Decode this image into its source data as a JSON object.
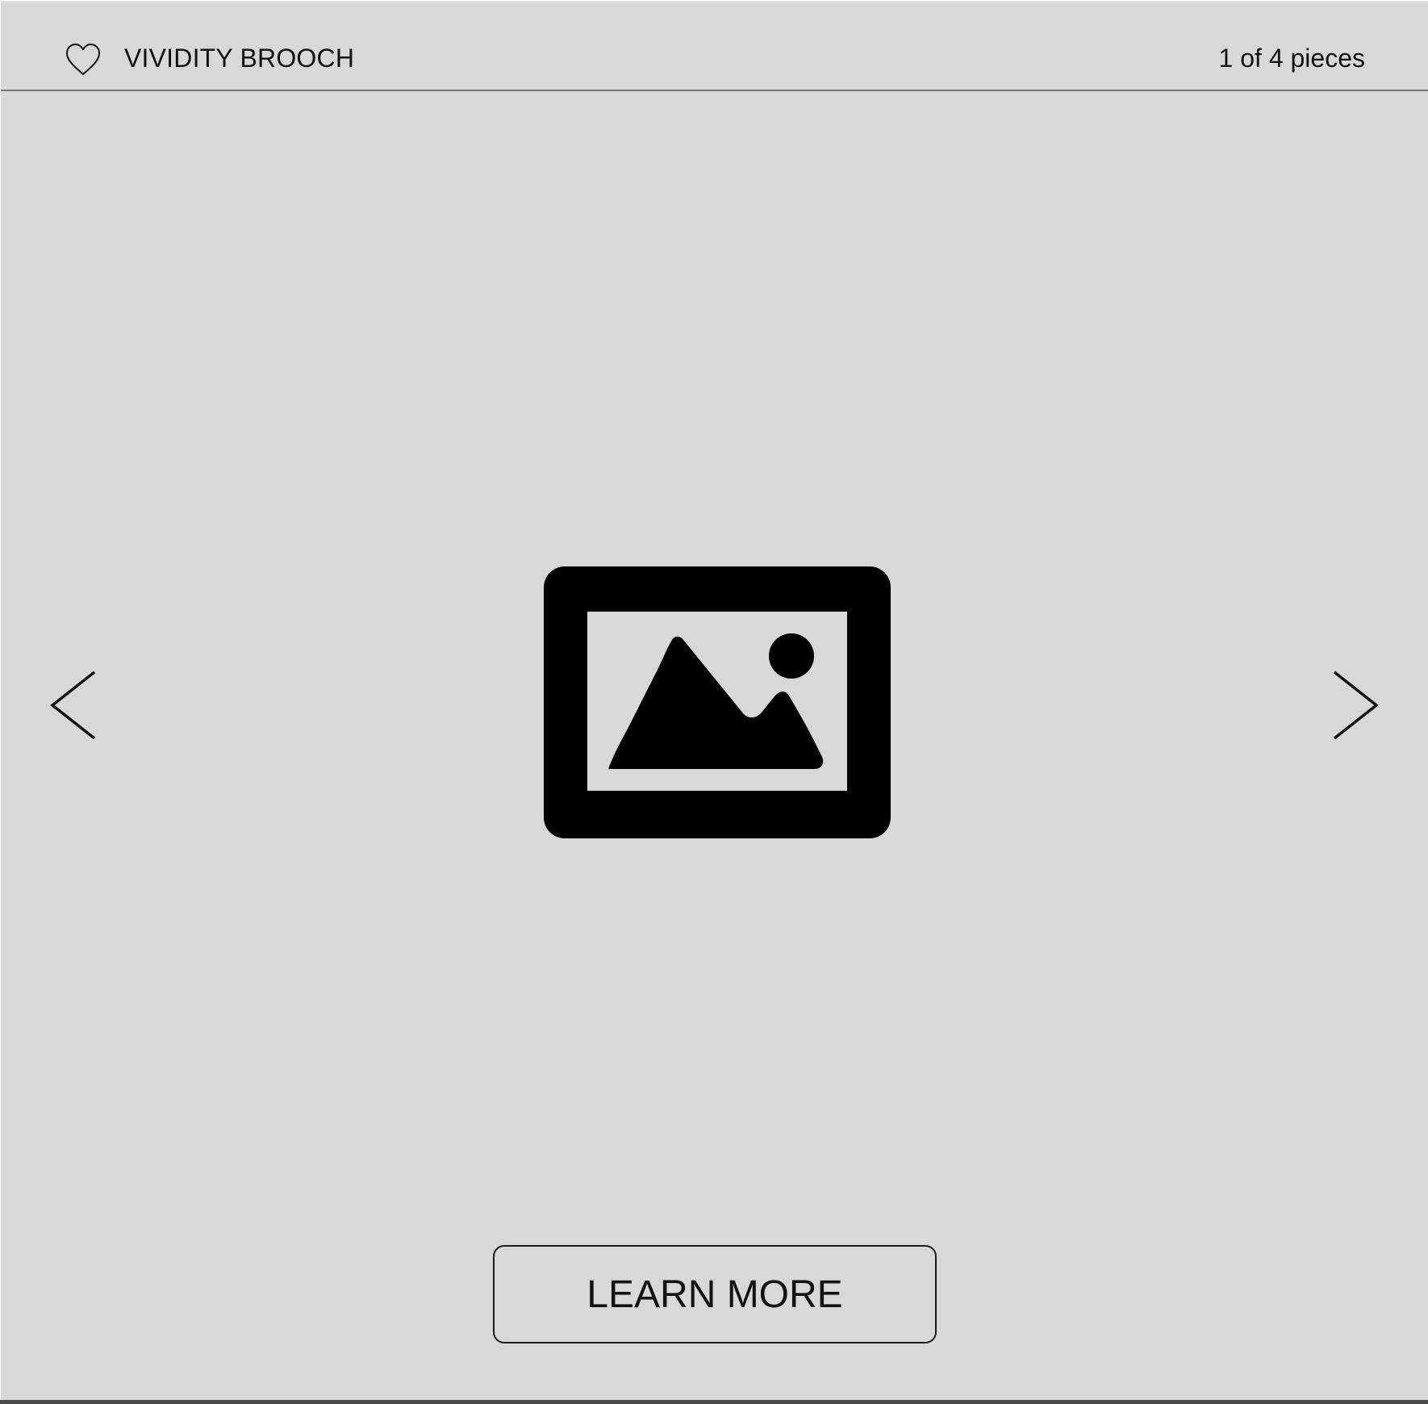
{
  "header": {
    "favorite_icon": "heart-outline-icon",
    "title": "VIVIDITY BROOCH",
    "counter": "1 of 4 pieces"
  },
  "carousel": {
    "prev_icon": "chevron-left-icon",
    "next_icon": "chevron-right-icon",
    "image_icon": "image-placeholder-icon"
  },
  "actions": {
    "learn_more_label": "LEARN MORE"
  },
  "colors": {
    "background": "#d8d8d8",
    "divider": "#7a7a7a",
    "foreground": "#111111"
  }
}
